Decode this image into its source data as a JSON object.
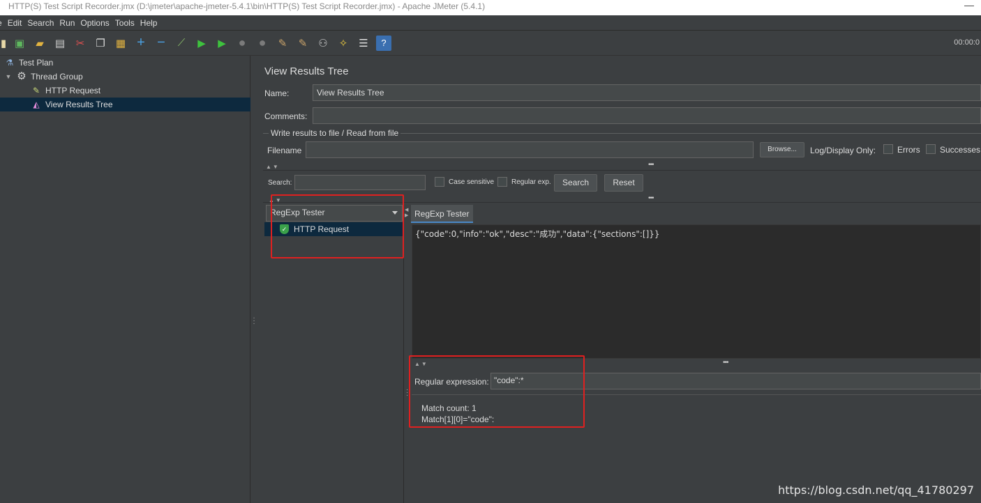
{
  "window": {
    "title": "HTTP(S) Test Script Recorder.jmx (D:\\jmeter\\apache-jmeter-5.4.1\\bin\\HTTP(S) Test Script Recorder.jmx) - Apache JMeter (5.4.1)",
    "minimize_glyph": "—"
  },
  "menu": [
    "e",
    "Edit",
    "Search",
    "Run",
    "Options",
    "Tools",
    "Help"
  ],
  "toolbar": {
    "timer": "00:00:0"
  },
  "tree": {
    "items": [
      {
        "label": "Test Plan",
        "icon": "flask-icon"
      },
      {
        "label": "Thread Group",
        "icon": "gear-icon"
      },
      {
        "label": "HTTP Request",
        "icon": "pipette-icon"
      },
      {
        "label": "View Results Tree",
        "icon": "chart-icon"
      }
    ]
  },
  "panel": {
    "title": "View Results Tree",
    "name_label": "Name:",
    "name_value": "View Results Tree",
    "comments_label": "Comments:",
    "comments_value": "",
    "file_group_title": "Write results to file / Read from file",
    "filename_label": "Filename",
    "filename_value": "",
    "browse_label": "Browse...",
    "log_display_label": "Log/Display Only:",
    "errors_label": "Errors",
    "successes_label": "Successes"
  },
  "search": {
    "label": "Search:",
    "value": "",
    "case_sensitive_label": "Case sensitive",
    "regular_exp_label": "Regular exp.",
    "search_button": "Search",
    "reset_button": "Reset"
  },
  "results": {
    "renderer": "RegExp Tester",
    "items": [
      "HTTP Request"
    ],
    "tab_label": "RegExp Tester",
    "response_body": "{\"code\":0,\"info\":\"ok\",\"desc\":\"成功\",\"data\":{\"sections\":[]}}",
    "regex_label": "Regular expression:",
    "regex_value": "\"code\":*",
    "match_count": "Match count: 1",
    "match_line": "Match[1][0]=\"code\":"
  },
  "watermark": "https://blog.csdn.net/qq_41780297",
  "colors": {
    "background": "#3c3f41",
    "selection": "#0d293e",
    "highlight_box": "#e02020"
  }
}
